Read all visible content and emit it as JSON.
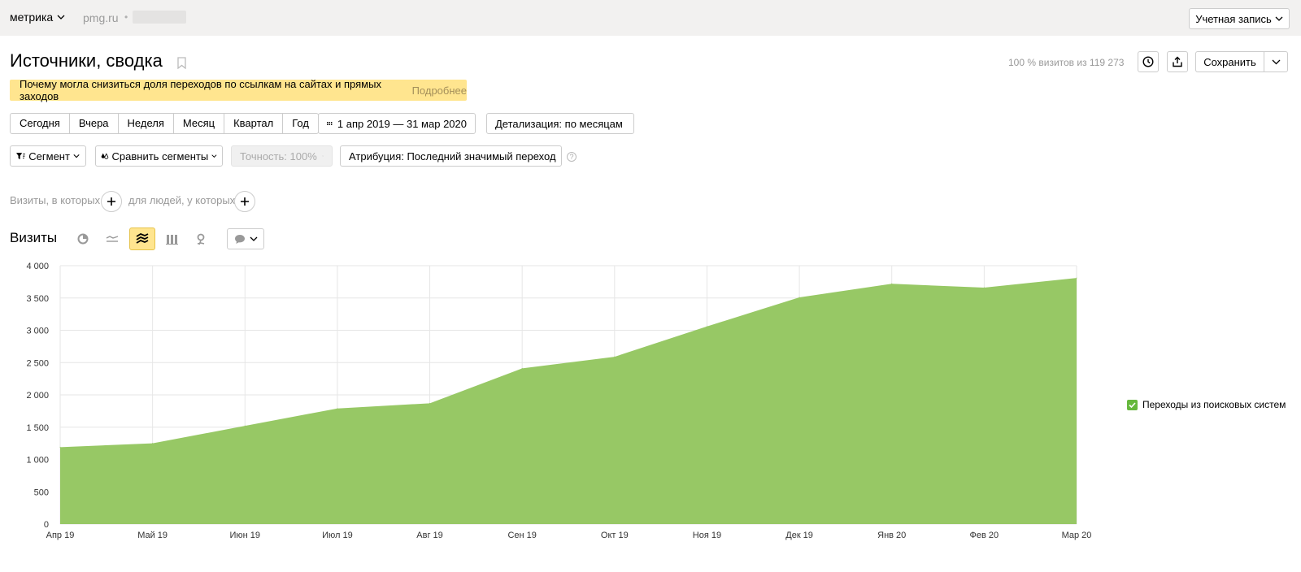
{
  "header": {
    "logo": "метрика",
    "site": "pmg.ru",
    "site_sep": "•",
    "account_label": "Учетная запись"
  },
  "page": {
    "title": "Источники, сводка",
    "visits_share": "100 % визитов из 119 273",
    "save_label": "Сохранить"
  },
  "notice": {
    "text": "Почему могла снизиться доля переходов по ссылкам на сайтах и прямых заходов",
    "link": "Подробнее"
  },
  "periods": [
    "Сегодня",
    "Вчера",
    "Неделя",
    "Месяц",
    "Квартал",
    "Год"
  ],
  "date_range": "1 апр 2019 — 31 мар 2020",
  "detail": "Детализация: по месяцам",
  "segment_label": "Сегмент",
  "compare_label": "Сравнить сегменты",
  "accuracy_label": "Точность: 100%",
  "attribution_label": "Атрибуция: Последний значимый переход",
  "filters": {
    "visits_label": "Визиты, в которых",
    "people_label": "для людей, у которых"
  },
  "chart_header": {
    "title": "Визиты",
    "types": [
      "pie-chart-icon",
      "line-chart-icon",
      "stacked-area-icon",
      "bar-chart-icon",
      "map-icon"
    ],
    "active_type": "stacked-area-icon"
  },
  "colors": {
    "accent_yellow": "#ffe58f",
    "series_green": "#97c865",
    "legend_green": "#66b83d"
  },
  "chart_data": {
    "type": "area",
    "categories": [
      "Апр 19",
      "Май 19",
      "Июн 19",
      "Июл 19",
      "Авг 19",
      "Сен 19",
      "Окт 19",
      "Ноя 19",
      "Дек 19",
      "Янв 20",
      "Фев 20",
      "Мар 20"
    ],
    "series": [
      {
        "name": "Переходы из поисковых систем",
        "values": [
          1190,
          1250,
          1520,
          1790,
          1870,
          2410,
          2590,
          3060,
          3510,
          3720,
          3660,
          3810
        ]
      }
    ],
    "yticks": [
      "0",
      "500",
      "1 000",
      "1 500",
      "2 000",
      "2 500",
      "3 000",
      "3 500",
      "4 000"
    ],
    "ylim": [
      0,
      4000
    ],
    "grid": true,
    "legend_position": "right"
  }
}
